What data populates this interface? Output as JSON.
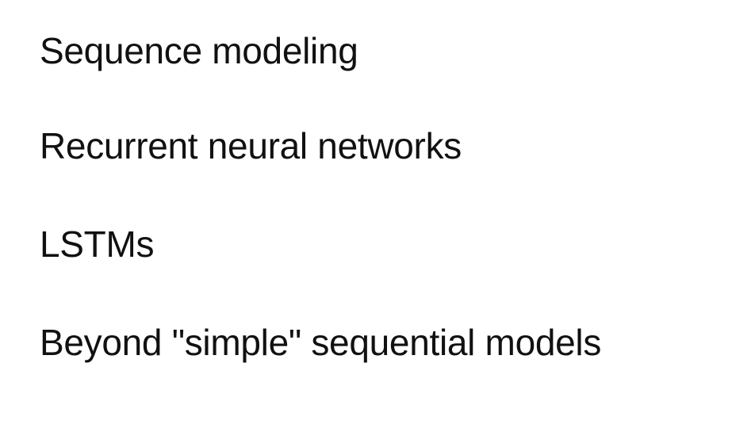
{
  "slide": {
    "items": [
      "Sequence modeling",
      "Recurrent neural networks",
      "LSTMs",
      "Beyond \"simple\" sequential models"
    ]
  },
  "colors": {
    "background": "#ffffff",
    "text": "#111111"
  }
}
